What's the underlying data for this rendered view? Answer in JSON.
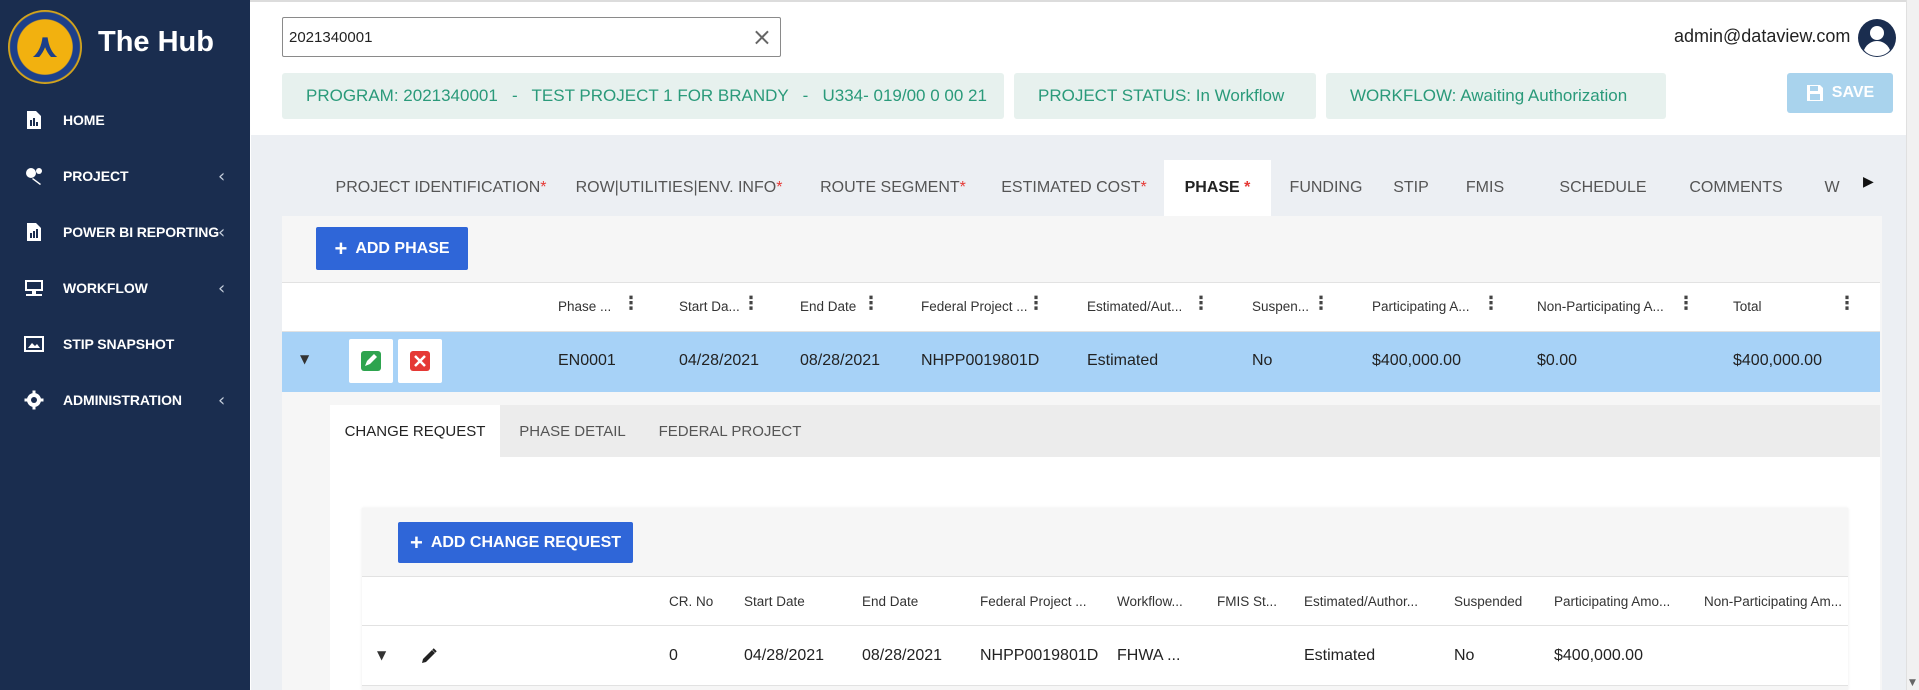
{
  "app": {
    "title": "The Hub"
  },
  "sidebar": {
    "items": [
      {
        "label": "HOME",
        "icon": "document-icon",
        "chevron": false
      },
      {
        "label": "PROJECT",
        "icon": "project-icon",
        "chevron": true
      },
      {
        "label": "POWER BI REPORTING",
        "icon": "report-icon",
        "chevron": true
      },
      {
        "label": "WORKFLOW",
        "icon": "workflow-icon",
        "chevron": true
      },
      {
        "label": "STIP SNAPSHOT",
        "icon": "snapshot-icon",
        "chevron": false
      },
      {
        "label": "ADMINISTRATION",
        "icon": "gear-icon",
        "chevron": true
      }
    ],
    "chevron_glyph": "‹"
  },
  "search": {
    "value": "2021340001",
    "clear_glyph": "×"
  },
  "user": {
    "email": "admin@dataview.com"
  },
  "info": {
    "program": "PROGRAM: 2021340001   -   TEST PROJECT 1 FOR BRANDY   -   U334- 019/00 0 00 21",
    "status": "PROJECT STATUS: In Workflow",
    "workflow": "WORKFLOW: Awaiting Authorization"
  },
  "save_label": "SAVE",
  "tabs": [
    {
      "label": "PROJECT IDENTIFICATION",
      "required": "*"
    },
    {
      "label": "ROW|UTILITIES|ENV. INFO",
      "required": "*"
    },
    {
      "label": "ROUTE SEGMENT",
      "required": "*"
    },
    {
      "label": "ESTIMATED COST",
      "required": "*"
    },
    {
      "label": "PHASE ",
      "required": "*"
    },
    {
      "label": "FUNDING",
      "required": ""
    },
    {
      "label": "STIP",
      "required": ""
    },
    {
      "label": "FMIS",
      "required": ""
    },
    {
      "label": "SCHEDULE",
      "required": ""
    },
    {
      "label": "COMMENTS",
      "required": ""
    },
    {
      "label": "W",
      "required": ""
    }
  ],
  "phase": {
    "add_label": "ADD PHASE",
    "plus": "+",
    "columns": [
      "Phase ...",
      "Start Da...",
      "End Date",
      "Federal Project ...",
      "Estimated/Aut...",
      "Suspen...",
      "Participating A...",
      "Non-Participating A...",
      "Total"
    ],
    "row": {
      "phase": "EN0001",
      "start": "04/28/2021",
      "end": "08/28/2021",
      "federal": "NHPP0019801D",
      "estimated": "Estimated",
      "suspended": "No",
      "participating": "$400,000.00",
      "non_participating": "$0.00",
      "total": "$400,000.00"
    }
  },
  "sub_tabs": [
    "CHANGE REQUEST",
    "PHASE DETAIL",
    "FEDERAL PROJECT"
  ],
  "change_request": {
    "add_label": "ADD CHANGE REQUEST",
    "columns": [
      "CR. No",
      "Start Date",
      "End Date",
      "Federal Project ...",
      "Workflow...",
      "FMIS St...",
      "Estimated/Author...",
      "Suspended",
      "Participating Amo...",
      "Non-Participating Am..."
    ],
    "row": {
      "cr_no": "0",
      "start": "04/28/2021",
      "end": "08/28/2021",
      "federal": "NHPP0019801D",
      "workflow": "FHWA ...",
      "fmis": "",
      "estimated": "Estimated",
      "suspended": "No",
      "participating": "$400,000.00",
      "non_participating": ""
    }
  },
  "colors": {
    "sidebar": "#1a2d4f",
    "primary": "#2f66d8",
    "selected_row": "#a7d2f7",
    "info_text": "#2a9a7a",
    "required": "#e53935"
  }
}
